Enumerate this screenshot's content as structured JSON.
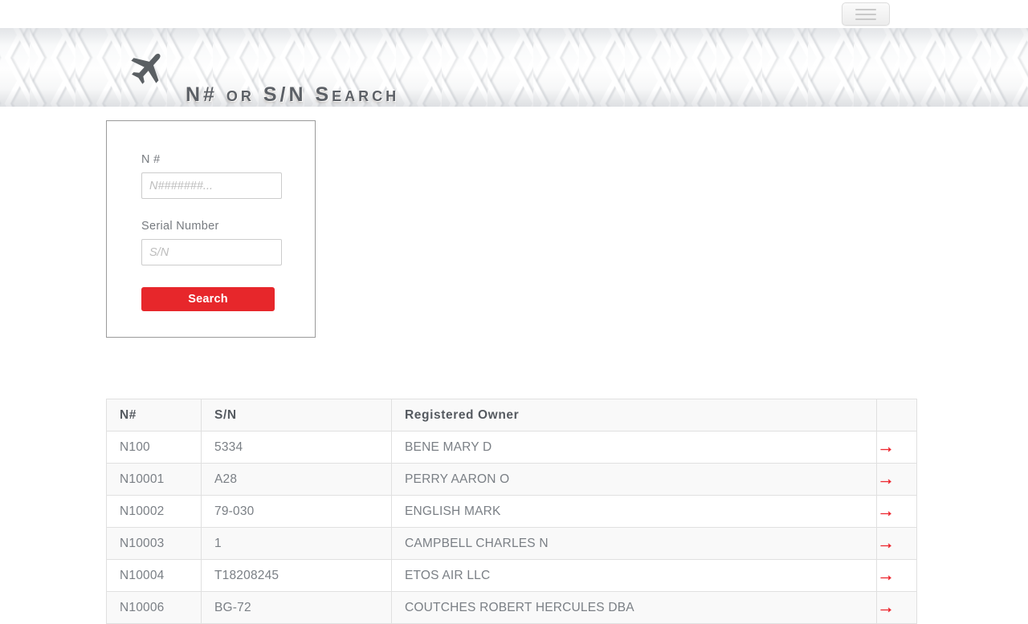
{
  "navbar": {
    "toggle_name": "hamburger-menu-button"
  },
  "header": {
    "title": "N# or S/N Search",
    "plane_icon": "airplane-icon"
  },
  "search_form": {
    "n_number": {
      "label": "N #",
      "placeholder": "N#######...",
      "value": ""
    },
    "serial_number": {
      "label": "Serial Number",
      "placeholder": "S/N",
      "value": ""
    },
    "submit_label": "Search",
    "submit_color": "#e7272b"
  },
  "results": {
    "columns": [
      "N#",
      "S/N",
      "Registered Owner",
      ""
    ],
    "rows": [
      {
        "n_number": "N100",
        "serial": "5334",
        "owner": "BENE MARY D",
        "action": "→"
      },
      {
        "n_number": "N10001",
        "serial": "A28",
        "owner": "PERRY AARON O",
        "action": "→"
      },
      {
        "n_number": "N10002",
        "serial": "79-030",
        "owner": "ENGLISH MARK",
        "action": "→"
      },
      {
        "n_number": "N10003",
        "serial": "1",
        "owner": "CAMPBELL CHARLES N",
        "action": "→"
      },
      {
        "n_number": "N10004",
        "serial": "T18208245",
        "owner": "ETOS AIR LLC",
        "action": "→"
      },
      {
        "n_number": "N10006",
        "serial": "BG-72",
        "owner": "COUTCHES ROBERT HERCULES DBA",
        "action": "→"
      }
    ],
    "arrow_color": "#ec1c24"
  }
}
